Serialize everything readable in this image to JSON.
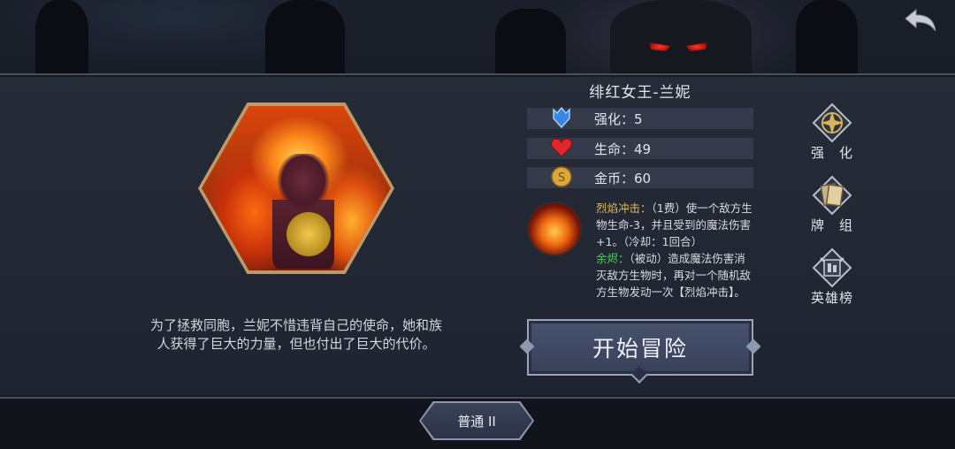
{
  "hero": {
    "name": "绯红女王-兰妮",
    "description": "为了拯救同胞，兰妮不惜违背自己的使命，她和族人获得了巨大的力量，但也付出了巨大的代价。"
  },
  "stats": [
    {
      "icon": "shield-icon",
      "label": "强化：5",
      "color": "#3a86e6"
    },
    {
      "icon": "heart-icon",
      "label": "生命：49",
      "color": "#e0282a"
    },
    {
      "icon": "coin-icon",
      "label": "金币：60",
      "color": "#d9a83a"
    }
  ],
  "skills": {
    "icon": "fireball-icon",
    "skill1_name": "烈焰冲击：",
    "skill1_desc": "（1费）使一个敌方生物生命-3，并且受到的魔法伤害+1。（冷却：1回合）",
    "skill2_name": "余烬：",
    "skill2_desc": "（被动）造成魔法伤害消灭敌方生物时，再对一个随机敌方生物发动一次【烈焰冲击】。"
  },
  "buttons": {
    "start": "开始冒险",
    "difficulty": "普通 II"
  },
  "side_menu": [
    {
      "icon": "upgrade-icon",
      "label": "强　化"
    },
    {
      "icon": "cards-icon",
      "label": "牌　组"
    },
    {
      "icon": "leaderboard-icon",
      "label": "英雄榜"
    }
  ]
}
